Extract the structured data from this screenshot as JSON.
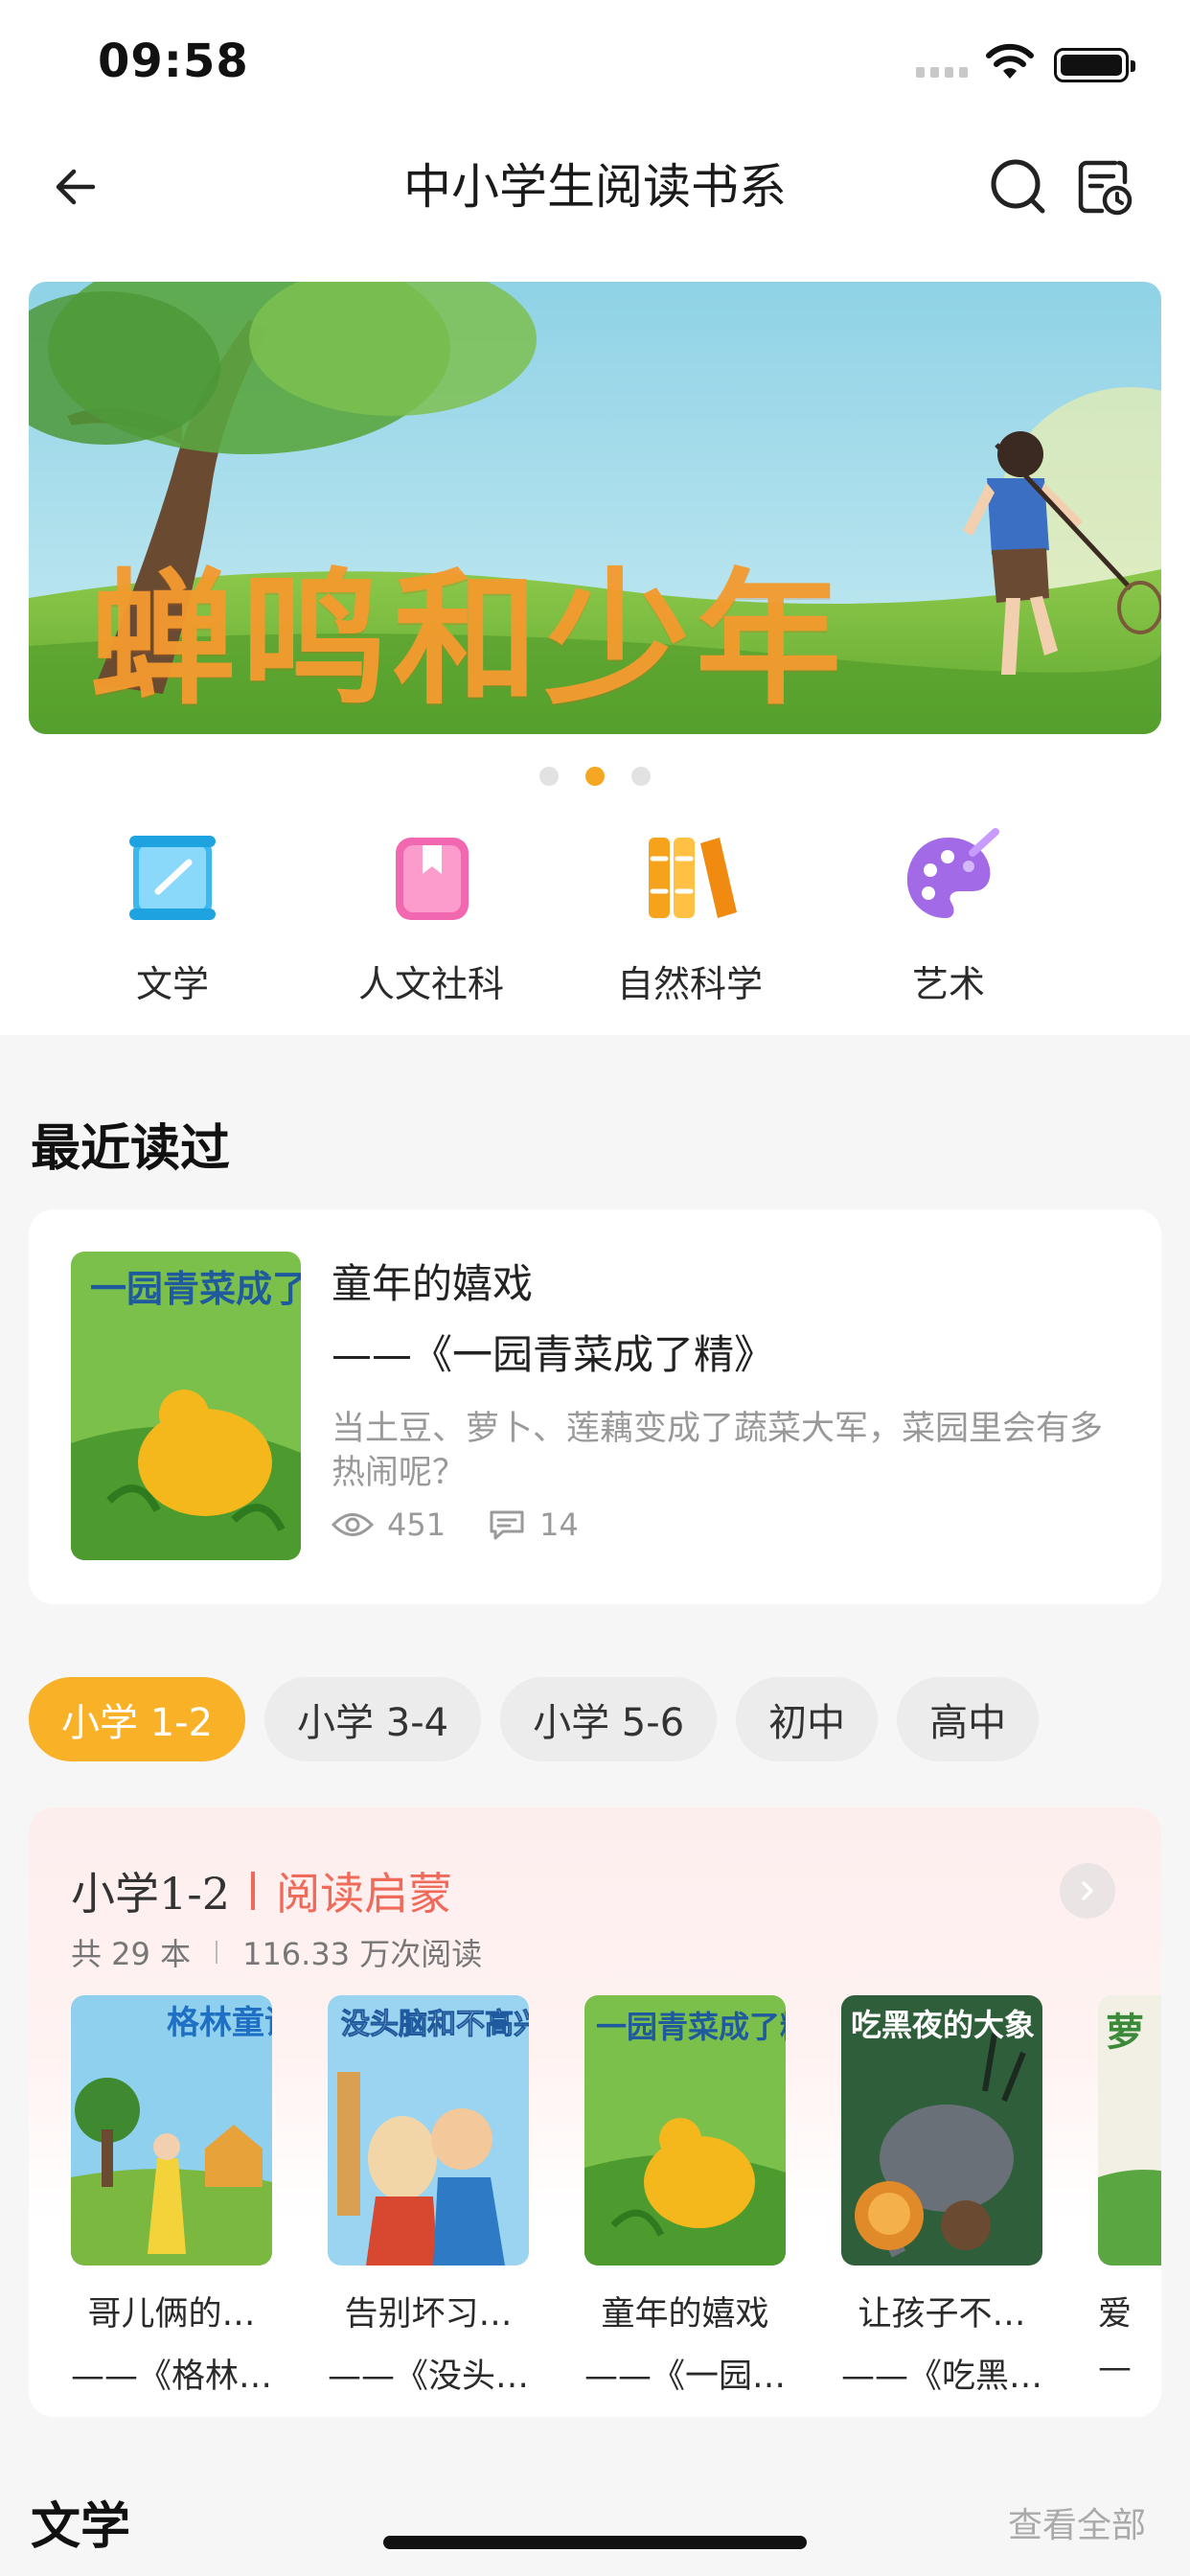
{
  "status_bar": {
    "time": "09:58"
  },
  "nav": {
    "title": "中小学生阅读书系"
  },
  "banner": {
    "title": "蝉鸣和少年"
  },
  "categories": [
    {
      "label": "文学",
      "icon": "book-scroll-icon",
      "color": "#3cb8ef"
    },
    {
      "label": "人文社科",
      "icon": "bookmark-book-icon",
      "color": "#f268b0"
    },
    {
      "label": "自然科学",
      "icon": "books-shelf-icon",
      "color": "#f7a21b"
    },
    {
      "label": "艺术",
      "icon": "palette-icon",
      "color": "#a36ae8"
    }
  ],
  "recent": {
    "heading": "最近读过",
    "title_line1": "童年的嬉戏",
    "title_line2": "——《一园青菜成了精》",
    "description": "当土豆、萝卜、莲藕变成了蔬菜大军，菜园里会有多热闹呢？",
    "views": "451",
    "comments": "14",
    "cover_text": "一园青菜成了精"
  },
  "grade_tabs": [
    {
      "label": "小学 1-2",
      "active": true
    },
    {
      "label": "小学 3-4",
      "active": false
    },
    {
      "label": "小学 5-6",
      "active": false
    },
    {
      "label": "初中",
      "active": false
    },
    {
      "label": "高中",
      "active": false
    }
  ],
  "level": {
    "name": "小学1-2",
    "subtitle": "阅读启蒙",
    "count": "共 29 本",
    "reads": "116.33 万次阅读",
    "books": [
      {
        "title": "哥儿俩的…",
        "subtitle": "——《格林…",
        "cover_text": "格林童话"
      },
      {
        "title": "告别坏习…",
        "subtitle": "——《没头…",
        "cover_text": "没头脑和不高兴"
      },
      {
        "title": "童年的嬉戏",
        "subtitle": "——《一园…",
        "cover_text": "一园青菜成了精"
      },
      {
        "title": "让孩子不…",
        "subtitle": "——《吃黑…",
        "cover_text": "吃黑夜的大象"
      },
      {
        "title": "爱",
        "subtitle": "—",
        "cover_text": "萝"
      }
    ]
  },
  "literature": {
    "heading": "文学",
    "view_all": "查看全部"
  }
}
